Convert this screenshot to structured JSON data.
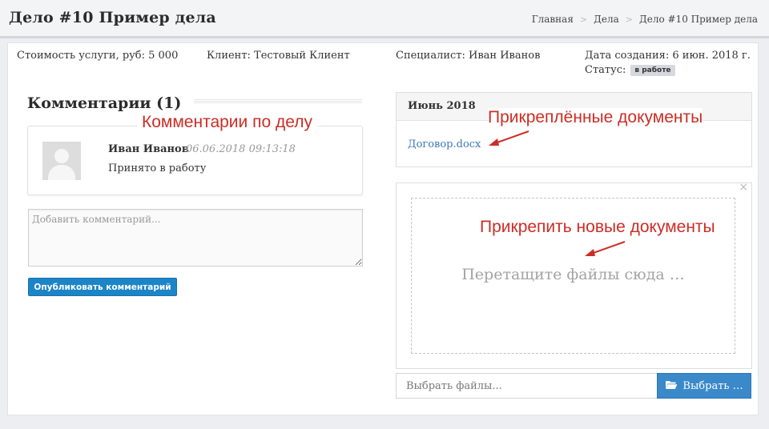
{
  "header": {
    "title": "Дело #10 Пример дела",
    "breadcrumb": {
      "home": "Главная",
      "cases": "Дела",
      "current": "Дело #10 Пример дела",
      "separator": ">"
    }
  },
  "case_info": {
    "cost": "Стоимость услуги, руб: 5 000",
    "client": "Клиент: Тестовый Клиент",
    "specialist": "Специалист: Иван Иванов",
    "created": "Дата создания: 6 июн. 2018 г.",
    "status_label": "Статус:",
    "status_badge": "в работе"
  },
  "comments": {
    "heading": "Комментарии (1)",
    "items": [
      {
        "author": "Иван Иванов",
        "date": "06.06.2018 09:13:18",
        "text": "Принято в работу"
      }
    ],
    "input_placeholder": "Добавить комментарий...",
    "publish_label": "Опубликовать комментарий"
  },
  "documents": {
    "month_header": "Июнь 2018",
    "files": [
      "Договор.docx"
    ]
  },
  "upload": {
    "close_glyph": "×",
    "dropzone_text": "Перетащите файлы сюда …",
    "file_placeholder": "Выбрать файлы...",
    "choose_label": "Выбрать …"
  },
  "annotations": {
    "comments": "Комментарии по делу",
    "attached_docs": "Прикреплённые документы",
    "attach_new": "Прикрепить новые документы"
  },
  "colors": {
    "primary_button": "#1c85c7",
    "choose_button": "#3a89c9",
    "link": "#3a7ab5",
    "annotation": "#cc2d25",
    "badge": "#d5d8de"
  },
  "icons": {
    "folder": "folder-open-icon",
    "avatar": "user-avatar-placeholder",
    "close": "close-icon"
  }
}
